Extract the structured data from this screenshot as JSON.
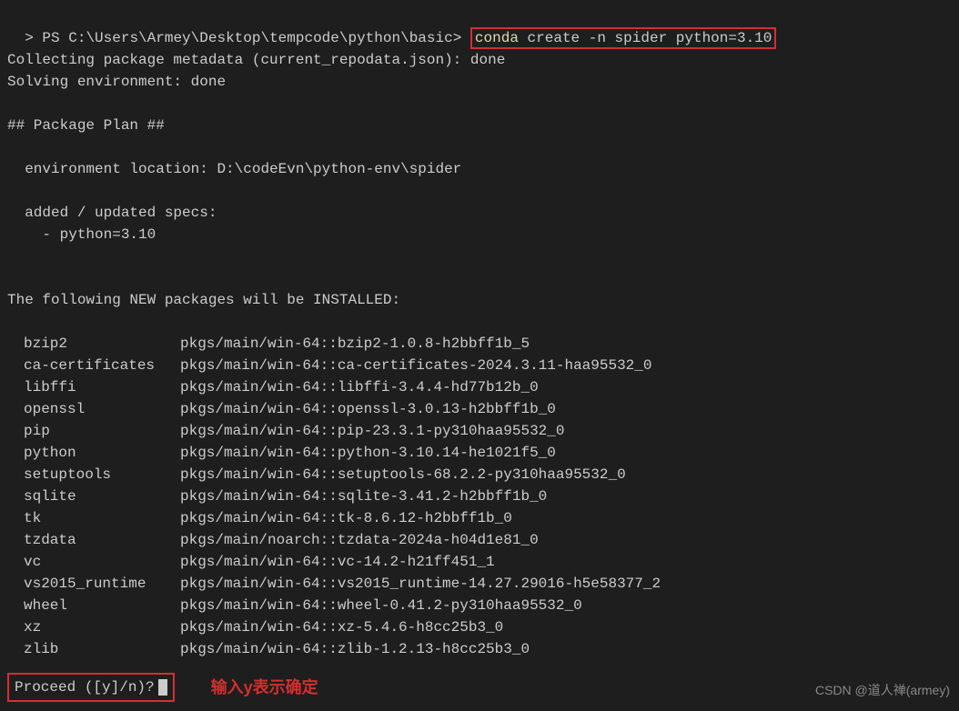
{
  "prompt": {
    "prefix": ">",
    "ps": "PS",
    "path": "C:\\Users\\Armey\\Desktop\\tempcode\\python\\basic>",
    "command_highlight": "conda",
    "command_rest": " create -n spider python=3.10"
  },
  "output": {
    "collecting": "Collecting package metadata (current_repodata.json): done",
    "solving": "Solving environment: done",
    "plan_header": "## Package Plan ##",
    "env_location": "  environment location: D:\\codeEvn\\python-env\\spider",
    "added_specs": "  added / updated specs:",
    "spec_item": "    - python=3.10",
    "install_header": "The following NEW packages will be INSTALLED:"
  },
  "packages": [
    {
      "name": "bzip2",
      "spec": "pkgs/main/win-64::bzip2-1.0.8-h2bbff1b_5"
    },
    {
      "name": "ca-certificates",
      "spec": "pkgs/main/win-64::ca-certificates-2024.3.11-haa95532_0"
    },
    {
      "name": "libffi",
      "spec": "pkgs/main/win-64::libffi-3.4.4-hd77b12b_0"
    },
    {
      "name": "openssl",
      "spec": "pkgs/main/win-64::openssl-3.0.13-h2bbff1b_0"
    },
    {
      "name": "pip",
      "spec": "pkgs/main/win-64::pip-23.3.1-py310haa95532_0"
    },
    {
      "name": "python",
      "spec": "pkgs/main/win-64::python-3.10.14-he1021f5_0"
    },
    {
      "name": "setuptools",
      "spec": "pkgs/main/win-64::setuptools-68.2.2-py310haa95532_0"
    },
    {
      "name": "sqlite",
      "spec": "pkgs/main/win-64::sqlite-3.41.2-h2bbff1b_0"
    },
    {
      "name": "tk",
      "spec": "pkgs/main/win-64::tk-8.6.12-h2bbff1b_0"
    },
    {
      "name": "tzdata",
      "spec": "pkgs/main/noarch::tzdata-2024a-h04d1e81_0"
    },
    {
      "name": "vc",
      "spec": "pkgs/main/win-64::vc-14.2-h21ff451_1"
    },
    {
      "name": "vs2015_runtime",
      "spec": "pkgs/main/win-64::vs2015_runtime-14.27.29016-h5e58377_2"
    },
    {
      "name": "wheel",
      "spec": "pkgs/main/win-64::wheel-0.41.2-py310haa95532_0"
    },
    {
      "name": "xz",
      "spec": "pkgs/main/win-64::xz-5.4.6-h8cc25b3_0"
    },
    {
      "name": "zlib",
      "spec": "pkgs/main/win-64::zlib-1.2.13-h8cc25b3_0"
    }
  ],
  "proceed": {
    "text": "Proceed ([y]/n)?"
  },
  "annotation": "输入y表示确定",
  "watermark": "CSDN @道人禅(armey)"
}
